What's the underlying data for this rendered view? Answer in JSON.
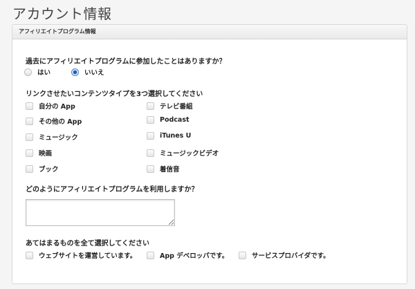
{
  "page": {
    "title": "アカウント情報"
  },
  "panel": {
    "title": "アフィリエイトプログラム情報"
  },
  "q1": {
    "label": "過去にアフィリエイトプログラムに参加したことはありますか？",
    "options": [
      "はい",
      "いいえ"
    ],
    "selected": "いいえ"
  },
  "q2": {
    "label": "リンクさせたいコンテンツタイプを3つ選択してください",
    "options": [
      "自分の App",
      "その他の App",
      "ミュージック",
      "映画",
      "ブック",
      "テレビ番組",
      "Podcast",
      "iTunes U",
      "ミュージックビデオ",
      "着信音"
    ]
  },
  "q3": {
    "label": "どのようにアフィリエイトプログラムを利用しますか？",
    "value": ""
  },
  "q4": {
    "label": "あてはまるものを全て選択してください",
    "options": [
      "ウェブサイトを運営しています。",
      "App デベロッパです。",
      "サービスプロバイダです。"
    ]
  },
  "colors": {
    "radio_selected": "#1e5fb5",
    "panel_border": "#d9d9d9",
    "background": "#f5f5f5"
  }
}
